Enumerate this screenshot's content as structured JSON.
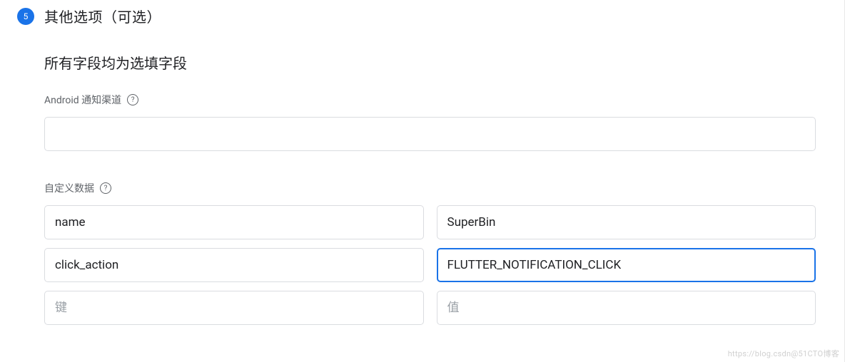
{
  "step": {
    "number": "5",
    "title": "其他选项（可选）"
  },
  "section": {
    "heading": "所有字段均为选填字段"
  },
  "androidChannel": {
    "label": "Android 通知渠道",
    "value": ""
  },
  "customData": {
    "label": "自定义数据",
    "rows": [
      {
        "key": "name",
        "value": "SuperBin"
      },
      {
        "key": "click_action",
        "value": "FLUTTER_NOTIFICATION_CLICK"
      },
      {
        "key": "",
        "value": ""
      }
    ],
    "keyPlaceholder": "键",
    "valuePlaceholder": "值"
  },
  "watermark": "https://blog.csdn@51CTO博客"
}
